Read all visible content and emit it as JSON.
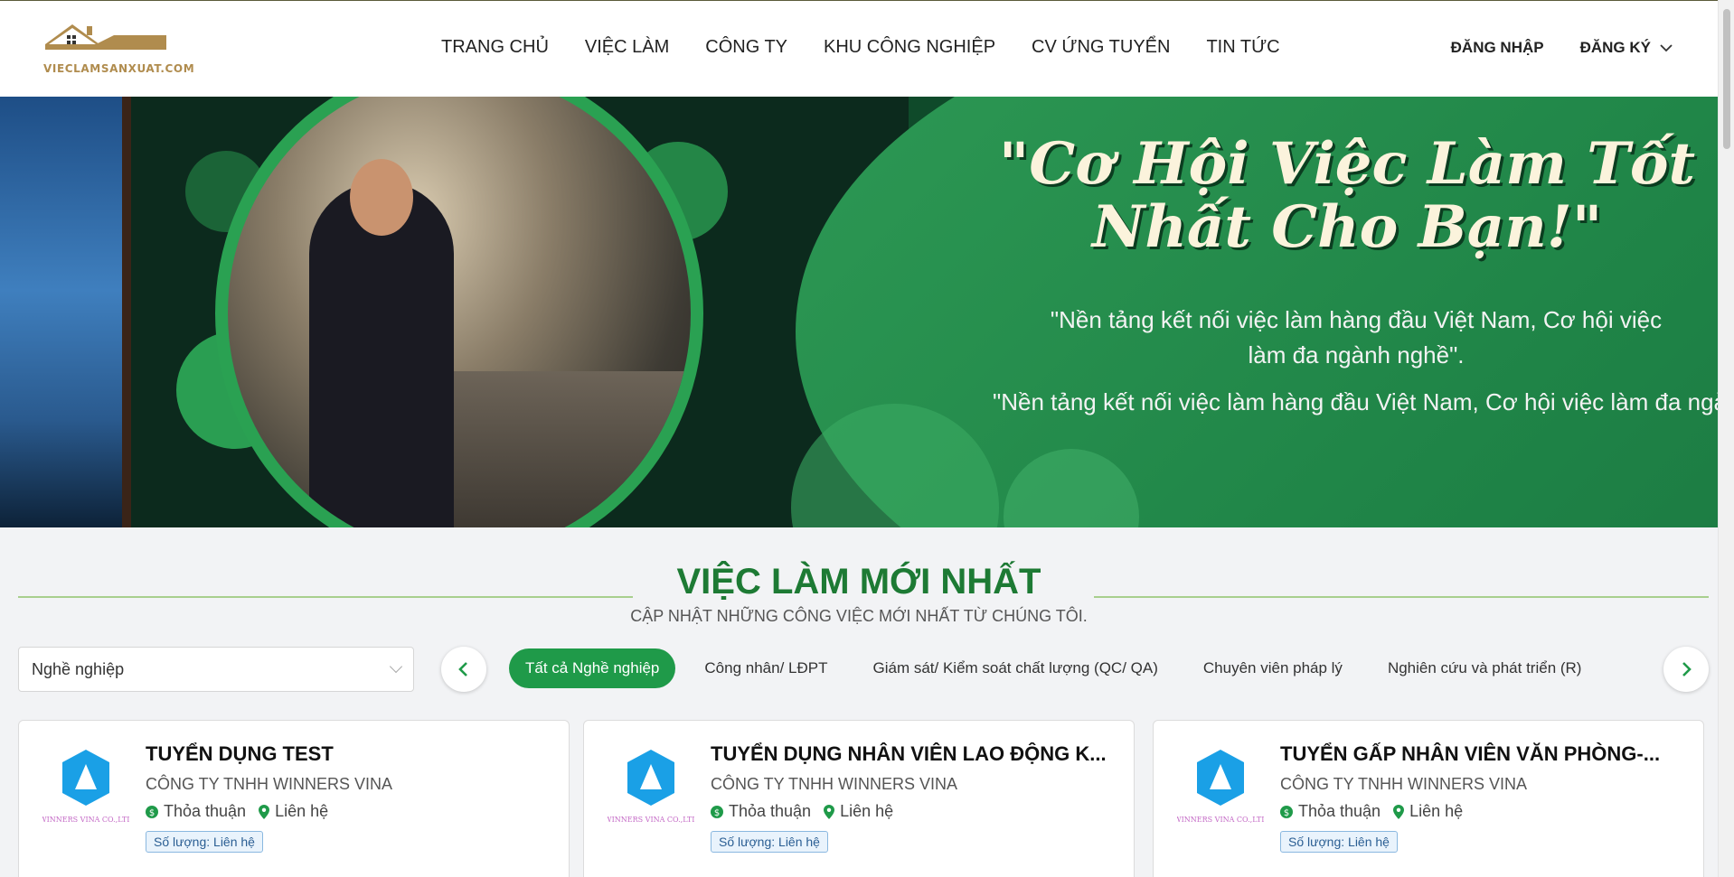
{
  "header": {
    "logo_text": "VIECLAMSANXUAT.COM",
    "nav": [
      "TRANG CHỦ",
      "VIỆC LÀM",
      "CÔNG TY",
      "KHU CÔNG NGHIỆP",
      "CV ỨNG TUYỂN",
      "TIN TỨC"
    ],
    "login": "ĐĂNG NHẬP",
    "register": "ĐĂNG KÝ"
  },
  "banner": {
    "headline_line1": "\"Cơ Hội Việc Làm Tốt",
    "headline_line2": "Nhất Cho Bạn!\"",
    "sub1": "\"Nền tảng kết nối việc làm hàng đầu Việt Nam, Cơ hội việc làm đa ngành nghề\".",
    "sub2": "\"Nền tảng kết nối việc làm hàng đầu Việt Nam, Cơ hội việc làm đa ngành n"
  },
  "section": {
    "title": "VIỆC LÀM MỚI NHẤT",
    "subtitle": "CẬP NHẬT NHỮNG CÔNG VIỆC MỚI NHẤT TỪ CHÚNG TÔI."
  },
  "filter": {
    "select_value": "Nghề nghiệp",
    "chips": [
      "Tất cả Nghề nghiệp",
      "Công nhân/ LĐPT",
      "Giám sát/ Kiểm soát chất lượng (QC/ QA)",
      "Chuyên viên pháp lý",
      "Nghiên cứu và phát triển (R)"
    ]
  },
  "jobs": [
    {
      "title": "TUYỂN DỤNG TEST",
      "company": "CÔNG TY TNHH WINNERS VINA",
      "salary": "Thỏa thuận",
      "location": "Liên hệ",
      "quantity": "Số lượng: Liên hệ",
      "logo_caption": "WINNERS VINA CO.,LTD"
    },
    {
      "title": "TUYỂN DỤNG NHÂN VIÊN LAO ĐỘNG K...",
      "company": "CÔNG TY TNHH WINNERS VINA",
      "salary": "Thỏa thuận",
      "location": "Liên hệ",
      "quantity": "Số lượng: Liên hệ",
      "logo_caption": "WINNERS VINA CO.,LTD"
    },
    {
      "title": "TUYỂN GẤP NHÂN VIÊN VĂN PHÒNG-...",
      "company": "CÔNG TY TNHH WINNERS VINA",
      "salary": "Thỏa thuận",
      "location": "Liên hệ",
      "quantity": "Số lượng: Liên hệ",
      "logo_caption": "WINNERS VINA CO.,LTD"
    }
  ],
  "colors": {
    "brand_green": "#1d7a34",
    "chip_active": "#1f9a49",
    "logo_gold": "#b08c4e",
    "company_logo_blue": "#1aa0e6"
  },
  "icons": {
    "prev": "chevron-left-icon",
    "next": "chevron-right-icon",
    "salary": "dollar-icon",
    "location": "map-pin-icon",
    "dropdown": "chevron-down-icon"
  }
}
